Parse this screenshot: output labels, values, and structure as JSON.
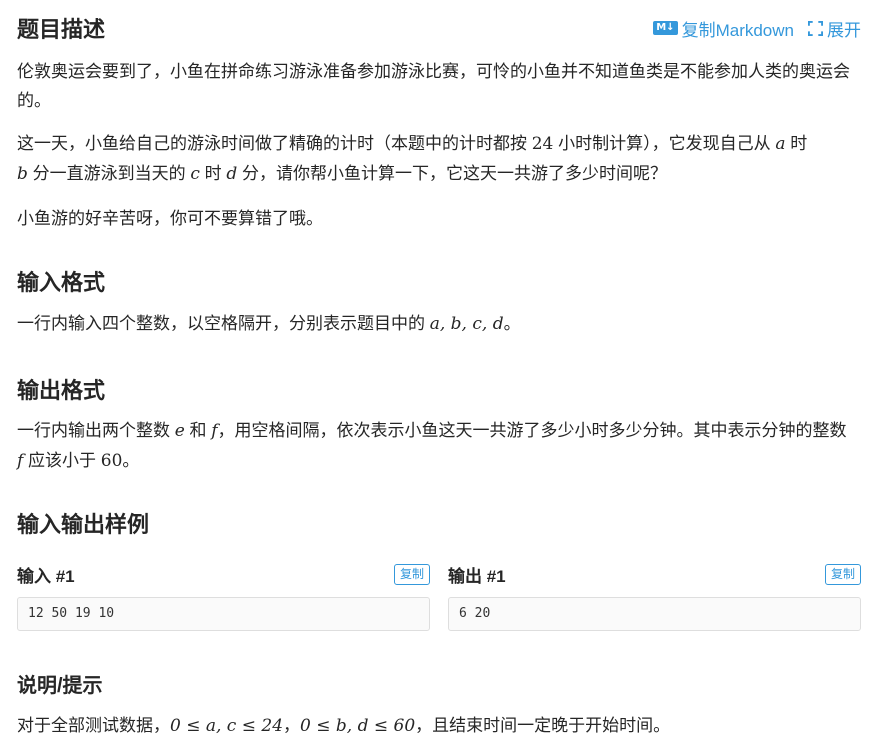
{
  "description": {
    "heading": "题目描述",
    "copy_markdown_label": "复制Markdown",
    "md_icon_text": "M↓",
    "expand_label": "展开",
    "p1": "伦敦奥运会要到了，小鱼在拼命练习游泳准备参加游泳比赛，可怜的小鱼并不知道鱼类是不能参加人类的奥运会的。",
    "p2_a": "这一天，小鱼给自己的游泳时间做了精确的计时（本题中的计时都按 ",
    "p2_24": "24",
    "p2_b": " 小时制计算），它发现自己从 ",
    "var_a": "a",
    "p2_c": " 时",
    "var_b": "b",
    "p2_d": " 分一直游泳到当天的 ",
    "var_c": "c",
    "p2_e": " 时 ",
    "var_d": "d",
    "p2_f": " 分，请你帮小鱼计算一下，它这天一共游了多少时间呢？",
    "p3": "小鱼游的好辛苦呀，你可不要算错了哦。"
  },
  "input_format": {
    "heading": "输入格式",
    "text": "一行内输入四个整数，以空格隔开，分别表示题目中的 ",
    "vars": "a, b, c, d",
    "end": "。"
  },
  "output_format": {
    "heading": "输出格式",
    "t1": "一行内输出两个整数 ",
    "var_e": "e",
    "t2": " 和 ",
    "var_f": "f",
    "t3": "，用空格间隔，依次表示小鱼这天一共游了多少小时多少分钟。其中表示分钟的整数 ",
    "var_f2": "f",
    "t4": " 应该小于 ",
    "num_60": "60",
    "t5": "。"
  },
  "samples": {
    "heading": "输入输出样例",
    "input_title": "输入 #1",
    "output_title": "输出 #1",
    "copy_label": "复制",
    "input_value": "12 50 19 10",
    "output_value": "6 20"
  },
  "hint": {
    "heading": "说明/提示",
    "t1": "对于全部测试数据，",
    "f1": "0 ≤ a, c ≤ 24",
    "t2": "，",
    "f2": "0 ≤ b, d ≤ 60",
    "t3": "，且结束时间一定晚于开始时间。"
  },
  "colors": {
    "accent": "#3498db",
    "text": "#262626",
    "code_bg": "#fafafa"
  }
}
